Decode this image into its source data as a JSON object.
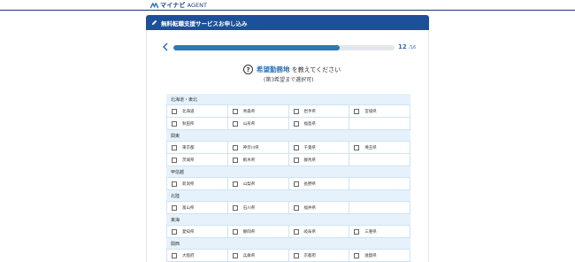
{
  "logo": {
    "brand": "マイナビ",
    "sub": "AGENT"
  },
  "header": {
    "title": "無料転職支援サービスお申し込み"
  },
  "progress": {
    "current": "12",
    "total": "/16",
    "fraction": 0.75
  },
  "question": {
    "icon": "?",
    "highlight": "希望勤務地",
    "rest": "を教えてください",
    "sub": "(第3希望まで選択可)"
  },
  "regions": [
    {
      "name": "北海道・東北",
      "rows": [
        [
          "北海道",
          "青森県",
          "岩手県",
          "宮城県"
        ],
        [
          "秋田県",
          "山形県",
          "福島県",
          ""
        ]
      ]
    },
    {
      "name": "関東",
      "rows": [
        [
          "東京都",
          "神奈川県",
          "千葉県",
          "埼玉県"
        ],
        [
          "茨城県",
          "栃木県",
          "群馬県",
          ""
        ]
      ]
    },
    {
      "name": "甲信越",
      "rows": [
        [
          "新潟県",
          "山梨県",
          "長野県",
          ""
        ]
      ]
    },
    {
      "name": "北陸",
      "rows": [
        [
          "富山県",
          "石川県",
          "福井県",
          ""
        ]
      ]
    },
    {
      "name": "東海",
      "rows": [
        [
          "愛知県",
          "静岡県",
          "岐阜県",
          "三重県"
        ]
      ]
    },
    {
      "name": "関西",
      "rows": [
        [
          "大阪府",
          "兵庫県",
          "京都府",
          "滋賀県"
        ]
      ]
    }
  ],
  "colors": {
    "navy": "#1e4f9a",
    "progress": "#2d77b6",
    "region_bg": "#e6f2fb"
  }
}
